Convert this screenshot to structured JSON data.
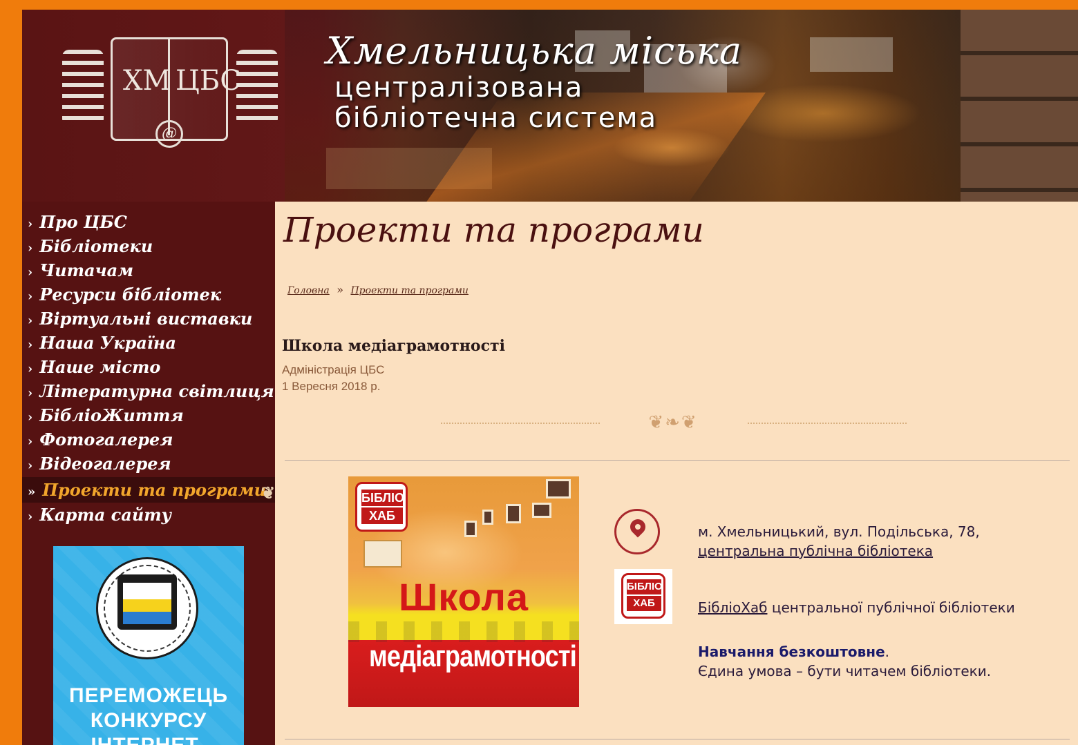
{
  "header": {
    "logo_text_left": "ХМ",
    "logo_text_right": "ЦБС",
    "logo_seal": "@",
    "title_script": "Хмельницька міська",
    "title_line1": "централізована",
    "title_line2": "бібліотечна система"
  },
  "sidebar": {
    "items": [
      {
        "label": "Про ЦБС",
        "active": false
      },
      {
        "label": "Бібліотеки",
        "active": false
      },
      {
        "label": "Читачам",
        "active": false
      },
      {
        "label": "Ресурси бібліотек",
        "active": false
      },
      {
        "label": "Віртуальні виставки",
        "active": false
      },
      {
        "label": "Наша Україна",
        "active": false
      },
      {
        "label": "Наше місто",
        "active": false
      },
      {
        "label": "Літературна світлиця",
        "active": false
      },
      {
        "label": "БібліоЖиття",
        "active": false
      },
      {
        "label": "Фотогалерея",
        "active": false
      },
      {
        "label": "Відеогалерея",
        "active": false
      },
      {
        "label": "Проекти та програми",
        "active": true
      },
      {
        "label": "Карта сайту",
        "active": false
      }
    ],
    "bullet": "›",
    "active_bullet": "»",
    "banner": {
      "line1": "ПЕРЕМОЖЕЦЬ",
      "line2": "КОНКУРСУ",
      "line3": "ІНТЕРНЕТ-САЙТІВ"
    }
  },
  "main": {
    "page_title": "Проекти та програми",
    "breadcrumb": {
      "home": "Головна",
      "separator": "»",
      "current": "Проекти та програми"
    },
    "article": {
      "title": "Школа медіаграмотності",
      "author": "Адміністрація ЦБС",
      "date": "1 Вересня 2018 р."
    },
    "promo": {
      "badge_top": "БІБЛІО",
      "badge_bottom": "ХАБ",
      "title_line1": "Школа",
      "title_line2": "медіаграмотності"
    },
    "info": {
      "address_line1": "м. Хмельницький, вул. Подільська, 78,",
      "address_link": "центральна публічна бібліотека",
      "hub_link": "БібліоХаб",
      "hub_text": " центральної публічної бібліотеки",
      "free_text": "Навчання безкоштовне",
      "free_dot": ".",
      "condition": "Єдина умова – бути читачем бібліотеки."
    }
  },
  "colors": {
    "page_border": "#f07c0c",
    "sidebar_bg": "#561212",
    "content_bg": "#fbe0c0",
    "active_nav_text": "#f2a62c",
    "accent_red": "#a8282c"
  }
}
